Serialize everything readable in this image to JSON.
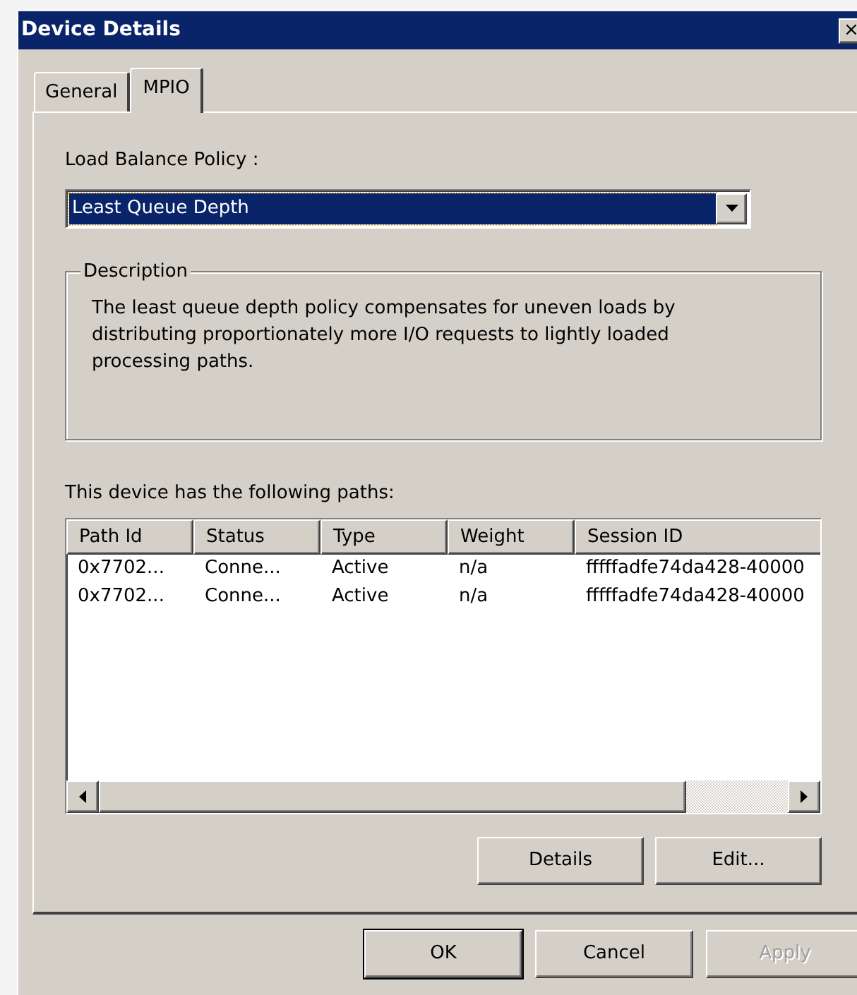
{
  "window": {
    "title": "Device Details",
    "close": "×"
  },
  "tabs": [
    {
      "label": "General",
      "selected": false
    },
    {
      "label": "MPIO",
      "selected": true
    }
  ],
  "policy": {
    "label": "Load Balance Policy :",
    "value": "Least Queue Depth"
  },
  "description": {
    "title": "Description",
    "text": "The least queue depth policy compensates for uneven loads by distributing proportionately more I/O requests to lightly loaded processing paths."
  },
  "paths": {
    "label": "This device has the following paths:",
    "columns": [
      "Path Id",
      "Status",
      "Type",
      "Weight",
      "Session ID"
    ],
    "rows": [
      [
        "0x7702...",
        "Conne...",
        "Active",
        "n/a",
        "fffffadfe74da428-40000"
      ],
      [
        "0x7702...",
        "Conne...",
        "Active",
        "n/a",
        "fffffadfe74da428-40000"
      ]
    ]
  },
  "path_buttons": [
    {
      "label": "Details",
      "disabled": false
    },
    {
      "label": "Edit...",
      "disabled": false
    }
  ],
  "buttons": [
    {
      "label": "OK",
      "disabled": false,
      "default": true
    },
    {
      "label": "Cancel",
      "disabled": false,
      "default": false
    },
    {
      "label": "Apply",
      "disabled": true,
      "default": false
    }
  ]
}
